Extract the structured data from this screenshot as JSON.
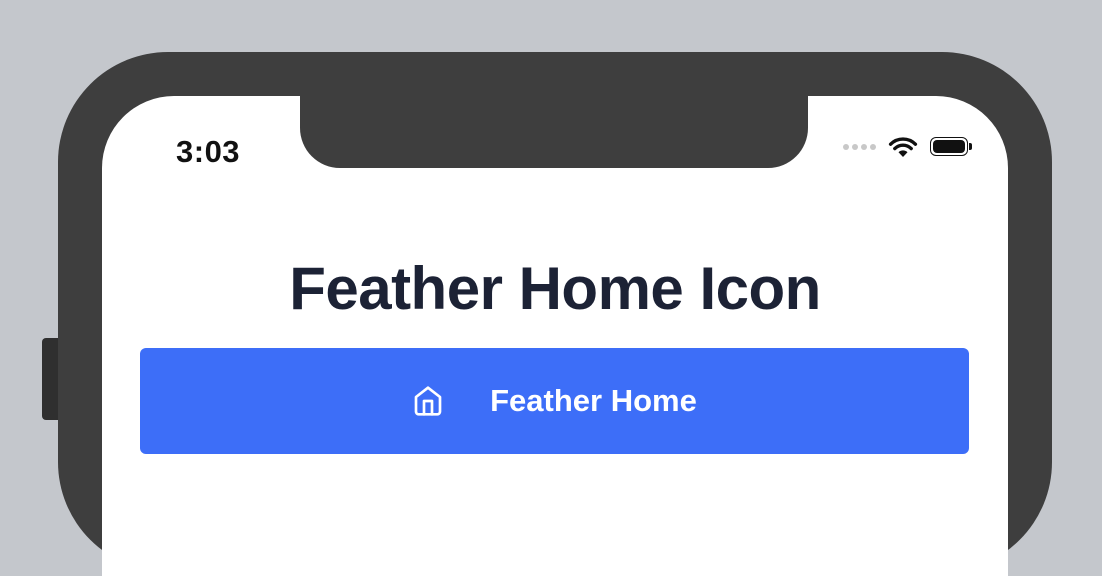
{
  "status_bar": {
    "time": "3:03"
  },
  "page": {
    "title": "Feather Home Icon"
  },
  "button": {
    "label": "Feather Home",
    "icon": "home-icon"
  },
  "colors": {
    "background": "#c4c7cc",
    "device_frame": "#3e3e3e",
    "button": "#3d6ef8",
    "title_text": "#1c2235"
  }
}
